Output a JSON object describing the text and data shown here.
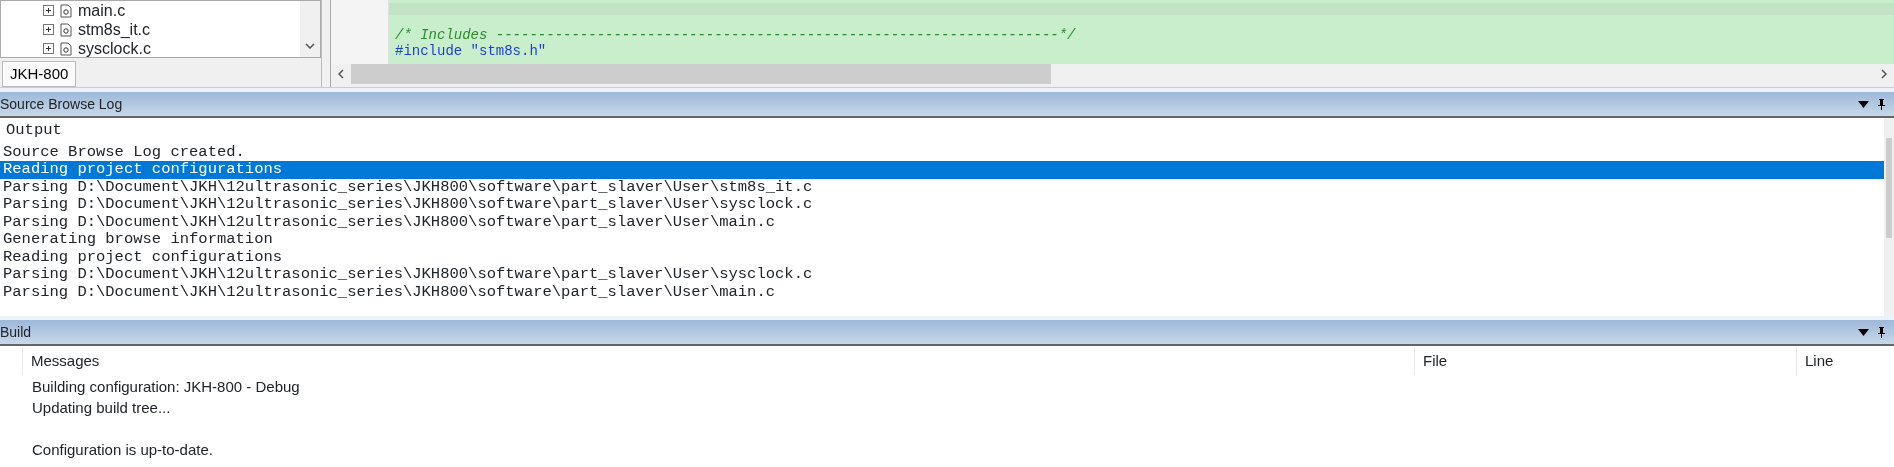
{
  "workspace": {
    "tree": [
      {
        "label": "main.c"
      },
      {
        "label": "stm8s_it.c"
      },
      {
        "label": "sysclock.c"
      }
    ],
    "tabs": [
      {
        "label": "JKH-800",
        "selected": true
      }
    ]
  },
  "editor": {
    "lines": [
      {
        "kind": "comment",
        "text": "/* Includes -------------------------------------------------------------------*/"
      },
      {
        "kind": "directive",
        "text": "#include \"stm8s.h\""
      }
    ]
  },
  "source_browse_log": {
    "title": "Source Browse Log",
    "heading": "Output",
    "lines": [
      {
        "text": "Source Browse Log created.",
        "selected": false
      },
      {
        "text": "Reading project configurations",
        "selected": true
      },
      {
        "text": "Parsing D:\\Document\\JKH\\12ultrasonic_series\\JKH800\\software\\part_slaver\\User\\stm8s_it.c",
        "selected": false
      },
      {
        "text": "Parsing D:\\Document\\JKH\\12ultrasonic_series\\JKH800\\software\\part_slaver\\User\\sysclock.c",
        "selected": false
      },
      {
        "text": "Parsing D:\\Document\\JKH\\12ultrasonic_series\\JKH800\\software\\part_slaver\\User\\main.c",
        "selected": false
      },
      {
        "text": "Generating browse information",
        "selected": false
      },
      {
        "text": "Reading project configurations",
        "selected": false
      },
      {
        "text": "Parsing D:\\Document\\JKH\\12ultrasonic_series\\JKH800\\software\\part_slaver\\User\\sysclock.c",
        "selected": false
      },
      {
        "text": "Parsing D:\\Document\\JKH\\12ultrasonic_series\\JKH800\\software\\part_slaver\\User\\main.c",
        "selected": false
      }
    ]
  },
  "build": {
    "title": "Build",
    "columns": [
      "Messages",
      "File",
      "Line"
    ],
    "messages": [
      {
        "kind": "message",
        "text": "Building configuration: JKH-800 - Debug"
      },
      {
        "kind": "message",
        "text": "Updating build tree..."
      },
      {
        "kind": "blank"
      },
      {
        "kind": "message",
        "text": "Configuration is up-to-date."
      }
    ]
  }
}
